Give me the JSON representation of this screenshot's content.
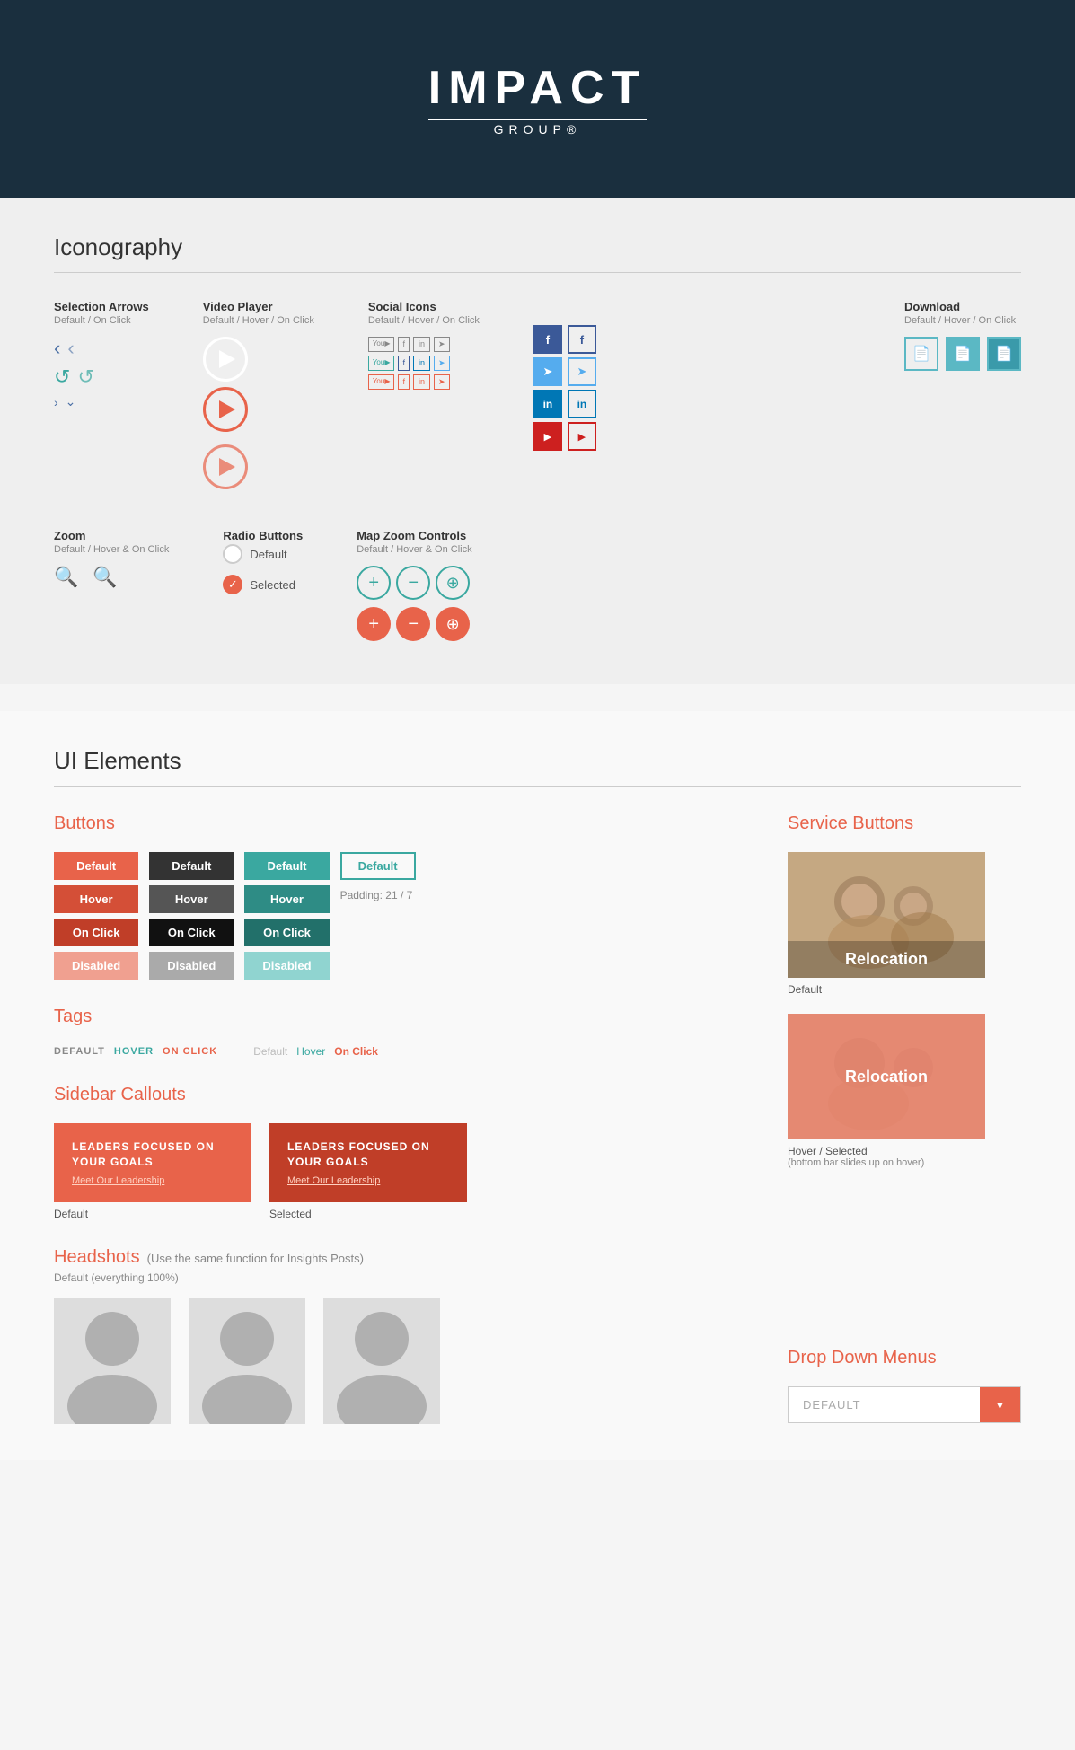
{
  "header": {
    "logo_text": "IMPACT",
    "logo_sub": "GROUP®"
  },
  "iconography": {
    "title": "Iconography",
    "selection_arrows": {
      "title": "Selection Arrows",
      "sub": "Default / On Click"
    },
    "video_player": {
      "title": "Video Player",
      "sub": "Default / Hover / On Click"
    },
    "social_icons": {
      "title": "Social Icons",
      "sub": "Default / Hover / On Click"
    },
    "download": {
      "title": "Download",
      "sub": "Default / Hover / On Click"
    },
    "zoom": {
      "title": "Zoom",
      "sub": "Default / Hover & On Click"
    },
    "radio_buttons": {
      "title": "Radio Buttons",
      "default_label": "Default",
      "selected_label": "Selected"
    },
    "map_zoom": {
      "title": "Map Zoom Controls",
      "sub": "Default / Hover & On Click"
    }
  },
  "ui_elements": {
    "title": "UI Elements",
    "buttons": {
      "title": "Buttons",
      "col1": [
        "Default",
        "Hover",
        "On Click",
        "Disabled"
      ],
      "col2": [
        "Default",
        "Hover",
        "On Click",
        "Disabled"
      ],
      "col3": [
        "Default",
        "Hover",
        "On Click",
        "Disabled"
      ],
      "col4_label": "Default",
      "padding_note": "Padding: 21 / 7"
    },
    "service_buttons": {
      "title": "Service Buttons",
      "btn1_text": "Relocation",
      "btn1_label": "Default",
      "btn2_text": "Relocation",
      "btn2_label": "Hover / Selected",
      "btn2_sublabel": "(bottom bar slides up on hover)"
    },
    "tags": {
      "title": "Tags",
      "items1": [
        "DEFAULT",
        "HOVER",
        "ON CLICK"
      ],
      "items2": [
        "Default",
        "Hover",
        "On Click"
      ]
    },
    "sidebar_callouts": {
      "title": "Sidebar Callouts",
      "box1_title": "LEADERS FOCUSED ON YOUR GOALS",
      "box1_link": "Meet Our Leadership",
      "box1_label": "Default",
      "box2_title": "LEADERS FOCUSED ON YOUR GOALS",
      "box2_link": "Meet Our Leadership",
      "box2_label": "Selected"
    },
    "headshots": {
      "title": "Headshots",
      "subtitle": "(Use the same function for Insights Posts)",
      "default_label": "Default (everything 100%)"
    },
    "dropdown": {
      "title": "Drop Down Menus",
      "placeholder": "DEFAULT",
      "arrow": "▼"
    }
  },
  "on_click_labels": [
    "On Click",
    "On Click",
    "On Click"
  ]
}
